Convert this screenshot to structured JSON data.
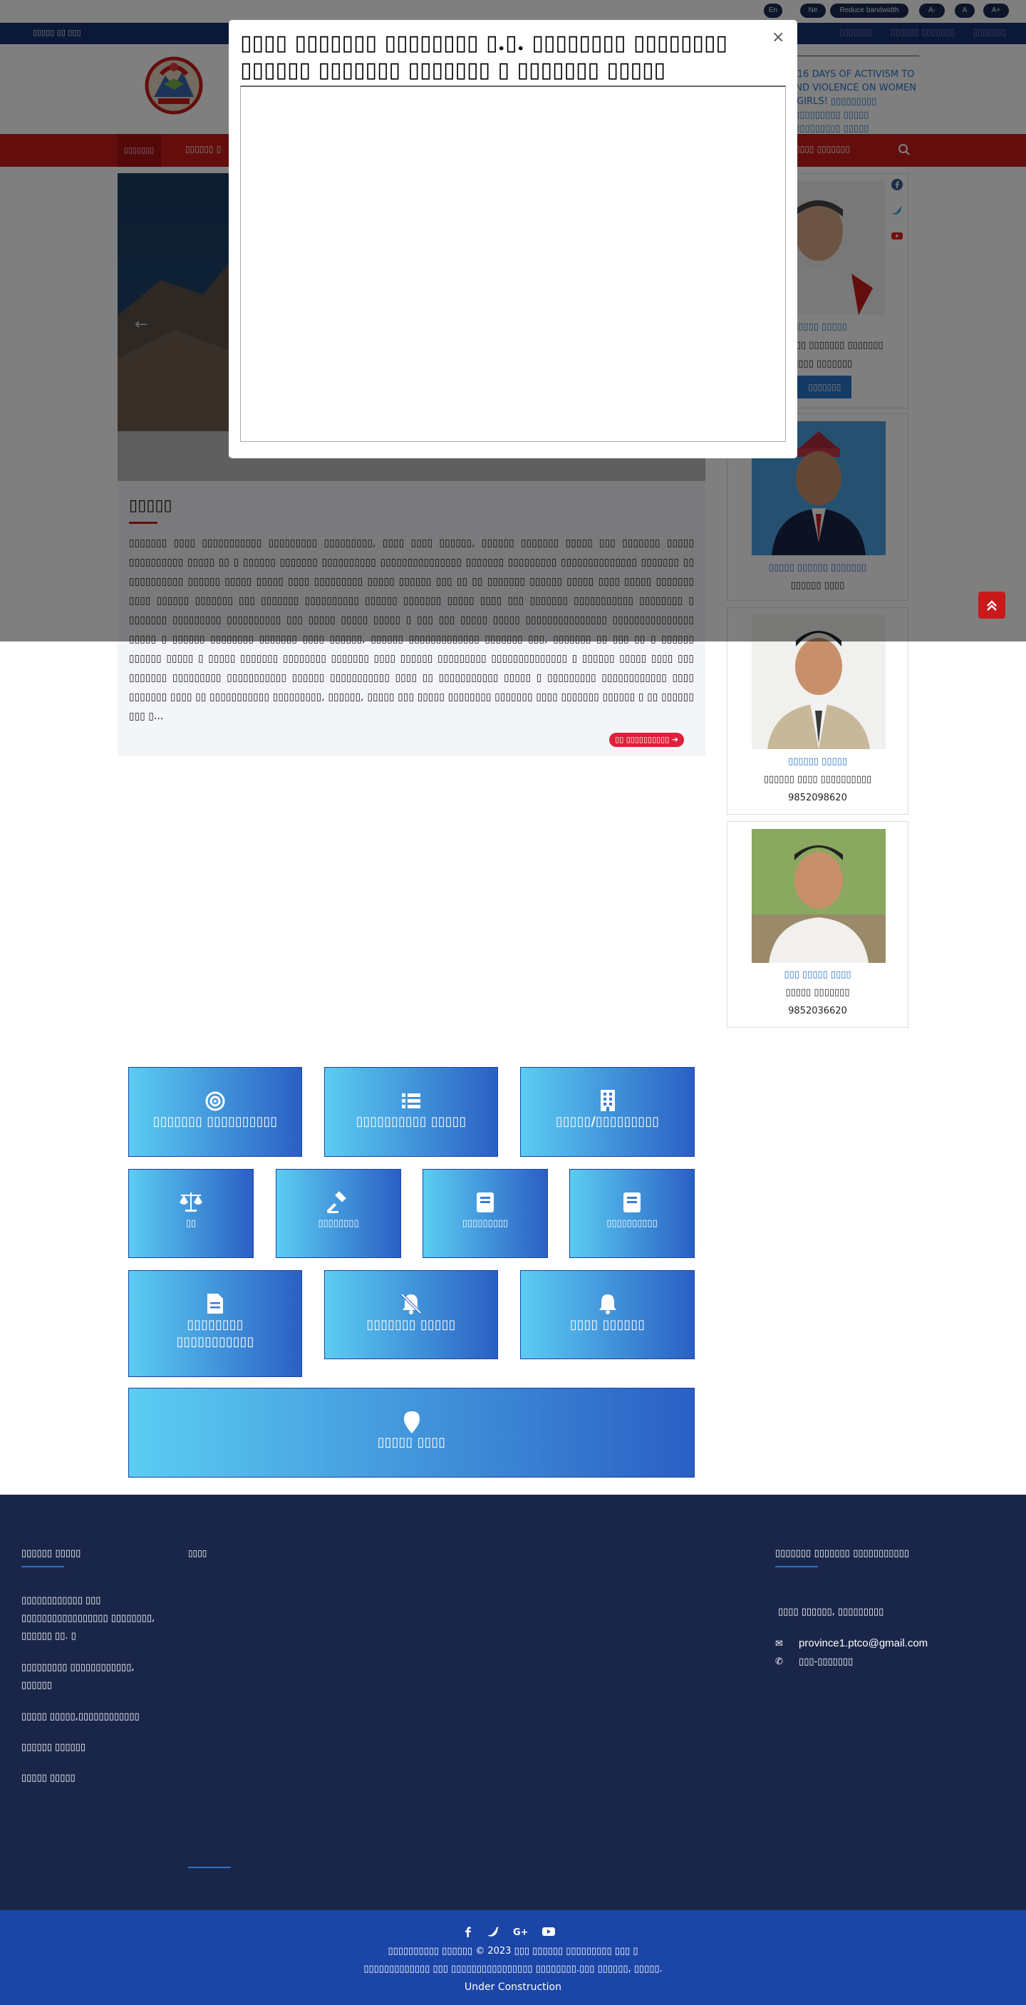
{
  "topbar": {
    "lang_en": "En",
    "lang_ne": "Ne",
    "reduce_bandwidth": "Reduce bandwidth",
    "font_minus": "A-",
    "font_reset": "A",
    "font_plus": "A+"
  },
  "bluebar": {
    "date": "▯▯▯▯▯ ▯▯ ▯▯▯",
    "links": [
      "▯▯▯▯▯▯▯",
      "▯▯▯▯▯▯ ▯▯▯▯▯▯▯",
      "▯▯▯▯▯▯▯"
    ]
  },
  "header": {
    "news_text": "#16 DAYS OF ACTIVISM TO END VIOLENCE ON WOMEN &GIRLS! ▯▯▯▯▯▯▯▯▯ ▯▯▯▯▯▯▯▯▯▯ ▯▯▯▯▯ ▯▯▯▯▯▯▯▯▯▯ ▯▯▯▯▯"
  },
  "nav": {
    "active": "▯▯▯▯▯▯▯",
    "item2": "▯▯▯▯▯▯ ▯",
    "item_last": "▯▯▯▯ ▯▯▯▯▯▯▯"
  },
  "about": {
    "title": "▯▯▯▯▯",
    "body": "▯▯▯▯▯▯▯ ▯▯▯▯ ▯▯▯▯▯▯▯▯▯▯▯ ▯▯▯▯▯▯▯▯▯ ▯▯▯▯▯▯▯▯▯, ▯▯▯▯ ▯▯▯▯ ▯▯▯▯▯▯, ▯▯▯▯▯▯ ▯▯▯▯▯▯▯ ▯▯▯▯▯ ▯▯▯ ▯▯▯▯▯▯▯ ▯▯▯▯▯ ▯▯▯▯▯▯▯▯▯▯ ▯▯▯▯▯ ▯▯ ▯ ▯▯▯▯▯▯ ▯▯▯▯▯▯▯ ▯▯▯▯▯▯▯▯▯▯ ▯▯▯▯▯▯▯▯▯▯▯▯▯▯▯ ▯▯▯▯▯▯▯ ▯▯▯▯▯▯▯▯▯ ▯▯▯▯▯▯▯▯▯▯▯▯▯▯ ▯▯▯▯▯▯▯ ▯▯ ▯▯▯▯▯▯▯▯▯▯ ▯▯▯▯▯▯ ▯▯▯▯▯ ▯▯▯▯▯ ▯▯▯▯ ▯▯▯▯▯▯▯▯▯ ▯▯▯▯▯ ▯▯▯▯▯▯ ▯▯▯ ▯▯ ▯▯ ▯▯▯▯▯▯▯ ▯▯▯▯▯▯ ▯▯▯▯▯ ▯▯▯▯ ▯▯▯▯▯ ▯▯▯▯▯▯▯ ▯▯▯▯ ▯▯▯▯▯▯ ▯▯▯▯▯▯▯ ▯▯▯ ▯▯▯▯▯▯▯ ▯▯▯▯▯▯▯▯▯▯ ▯▯▯▯▯▯ ▯▯▯▯▯▯▯ ▯▯▯▯▯ ▯▯▯▯ ▯▯▯ ▯▯▯▯▯▯▯ ▯▯▯▯▯▯▯▯▯▯▯ ▯▯▯▯▯▯▯▯ ▯ ▯▯▯▯▯▯▯ ▯▯▯▯▯▯▯▯▯ ▯▯▯▯▯▯▯▯▯▯ ▯▯▯ ▯▯▯▯▯ ▯▯▯▯▯ ▯▯▯▯▯ ▯ ▯▯▯ ▯▯▯ ▯▯▯▯▯ ▯▯▯▯▯ ▯▯▯▯▯▯▯▯▯▯▯▯▯▯▯ ▯▯▯▯▯▯▯▯▯▯▯▯▯▯▯ ▯▯▯▯▯ ▯ ▯▯▯▯▯▯ ▯▯▯▯▯▯▯▯ ▯▯▯▯▯▯▯ ▯▯▯▯ ▯▯▯▯▯▯, ▯▯▯▯▯▯ ▯▯▯▯▯▯▯▯▯▯▯▯▯ ▯▯▯▯▯▯▯ ▯▯▯, ▯▯▯▯▯▯▯ ▯▯ ▯▯▯ ▯▯ ▯ ▯▯▯▯▯▯ ▯▯▯▯▯▯ ▯▯▯▯▯ ▯ ▯▯▯▯▯ ▯▯▯▯▯▯▯ ▯▯▯▯▯▯▯▯ ▯▯▯▯▯▯▯ ▯▯▯▯ ▯▯▯▯▯▯ ▯▯▯▯▯▯▯▯▯ ▯▯▯▯▯▯▯▯▯▯▯▯▯▯ ▯ ▯▯▯▯▯▯ ▯▯▯▯▯ ▯▯▯▯ ▯▯▯ ▯▯▯▯▯▯▯ ▯▯▯▯▯▯▯▯▯ ▯▯▯▯▯▯▯▯▯▯▯ ▯▯▯▯▯▯ ▯▯▯▯▯▯▯▯▯▯▯ ▯▯▯▯ ▯▯ ▯▯▯▯▯▯▯▯▯▯▯ ▯▯▯▯▯ ▯ ▯▯▯▯▯▯▯▯▯ ▯▯▯▯▯▯▯▯▯▯▯▯ ▯▯▯▯ ▯▯▯▯▯▯▯ ▯▯▯▯ ▯▯ ▯▯▯▯▯▯▯▯▯▯▯ ▯▯▯▯▯▯▯▯▯, ▯▯▯▯▯▯, ▯▯▯▯▯ ▯▯▯ ▯▯▯▯▯ ▯▯▯▯▯▯▯▯ ▯▯▯▯▯▯▯ ▯▯▯▯ ▯▯▯▯▯▯▯ ▯▯▯▯▯▯ ▯ ▯▯ ▯▯▯▯▯▯ ▯▯▯ ▯...",
    "more": "▯▯ ▯▯▯▯▯▯▯▯▯▯"
  },
  "officials": [
    {
      "name": "▯▯▯▯▯▯ ▯▯▯▯▯",
      "role": "▯▯▯▯▯▯▯▯ ▯▯ ▯▯▯▯▯▯▯ ▯▯▯▯▯▯▯",
      "phone": "▯▯▯▯▯▯ ▯▯▯▯▯▯▯",
      "btn": "▯▯▯▯▯▯▯"
    },
    {
      "name": "▯▯▯▯▯ ▯▯▯▯▯▯ ▯▯▯▯▯▯▯",
      "role": "▯▯▯▯▯▯ ▯▯▯▯",
      "phone": ""
    },
    {
      "name": "▯▯▯▯▯▯ ▯▯▯▯▯",
      "role": "▯▯▯▯▯▯ ▯▯▯▯ ▯▯▯▯▯▯▯▯▯▯",
      "phone": "9852098620"
    },
    {
      "name": "▯▯▯ ▯▯▯▯▯ ▯▯▯▯",
      "role": "▯▯▯▯▯ ▯▯▯▯▯▯▯",
      "phone": "9852036620"
    }
  ],
  "tiles": {
    "t1": "▯▯▯▯▯▯▯ ▯▯▯▯▯▯▯▯▯▯",
    "t2": "▯▯▯▯▯▯▯▯▯▯ ▯▯▯▯▯",
    "t3": "▯▯▯▯▯/▯▯▯▯▯▯▯▯▯",
    "t4": "▯▯",
    "t5": "▯▯▯▯▯▯▯▯",
    "t6": "▯▯▯▯▯▯▯▯▯",
    "t7": "▯▯▯▯▯▯▯▯▯▯",
    "t8_line1": "▯▯▯▯▯▯▯▯",
    "t8_line2": "▯▯▯▯▯▯▯▯▯▯▯",
    "t9": "▯▯▯▯▯▯▯ ▯▯▯▯▯",
    "t10": "▯▯▯▯ ▯▯▯▯▯▯",
    "t11": "▯▯▯▯▯ ▯▯▯▯"
  },
  "footer": {
    "col1_title": "▯▯▯▯▯▯ ▯▯▯▯▯",
    "col1_links": [
      "▯▯▯▯▯▯▯▯▯▯▯▯ ▯▯▯",
      "▯▯▯▯▯▯▯▯▯▯▯▯▯▯▯▯▯ ▯▯▯▯▯▯▯▯,",
      "▯▯▯▯▯▯ ▯▯. ▯",
      "▯▯▯▯▯▯▯▯▯ ▯▯▯▯▯▯▯▯▯▯▯▯,",
      "▯▯▯▯▯▯",
      "▯▯▯▯▯ ▯▯▯▯▯,▯▯▯▯▯▯▯▯▯▯▯▯",
      "▯▯▯▯▯▯ ▯▯▯▯▯▯",
      "▯▯▯▯▯ ▯▯▯▯▯"
    ],
    "col2_title": "▯▯▯▯",
    "col3_title": "▯▯▯▯▯▯▯ ▯▯▯▯▯▯▯ ▯▯▯▯▯▯▯▯▯▯▯",
    "address": "▯▯▯▯ ▯▯▯▯▯▯, ▯▯▯▯▯▯▯▯▯",
    "email": "province1.ptco@gmail.com",
    "phone": "▯▯▯-▯▯▯▯▯▯▯"
  },
  "bottom": {
    "copyright": "▯▯▯▯▯▯▯▯▯▯ ▯▯▯▯▯▯ © 2023 ▯▯▯ ▯▯▯▯▯▯ ▯▯▯▯▯▯▯▯▯ ▯▯▯ ▯",
    "office": "▯▯▯▯▯▯▯▯▯▯▯▯▯ ▯▯▯ ▯▯▯▯▯▯▯▯▯▯▯▯▯▯▯▯ ▯▯▯▯▯▯▯▯.▯▯▯ ▯▯▯▯▯▯, ▯▯▯▯▯.",
    "status": "Under Construction"
  },
  "modal": {
    "title": "▯▯▯▯ ▯▯▯▯▯▯▯ ▯▯▯▯▯▯▯▯ ▯.▯. ▯▯▯▯▯▯▯▯ ▯▯▯▯▯▯▯▯ ▯▯▯▯▯▯ ▯▯▯▯▯▯▯ ▯▯▯▯▯▯▯ ▯ ▯▯▯▯▯▯▯ ▯▯▯▯▯",
    "close": "×"
  },
  "colors": {
    "nav_red": "#c81a1a",
    "top_blue": "#16316e",
    "footer_navy": "#1a2649",
    "bottom_blue": "#1b45a6",
    "link_blue": "#2a74c8"
  }
}
